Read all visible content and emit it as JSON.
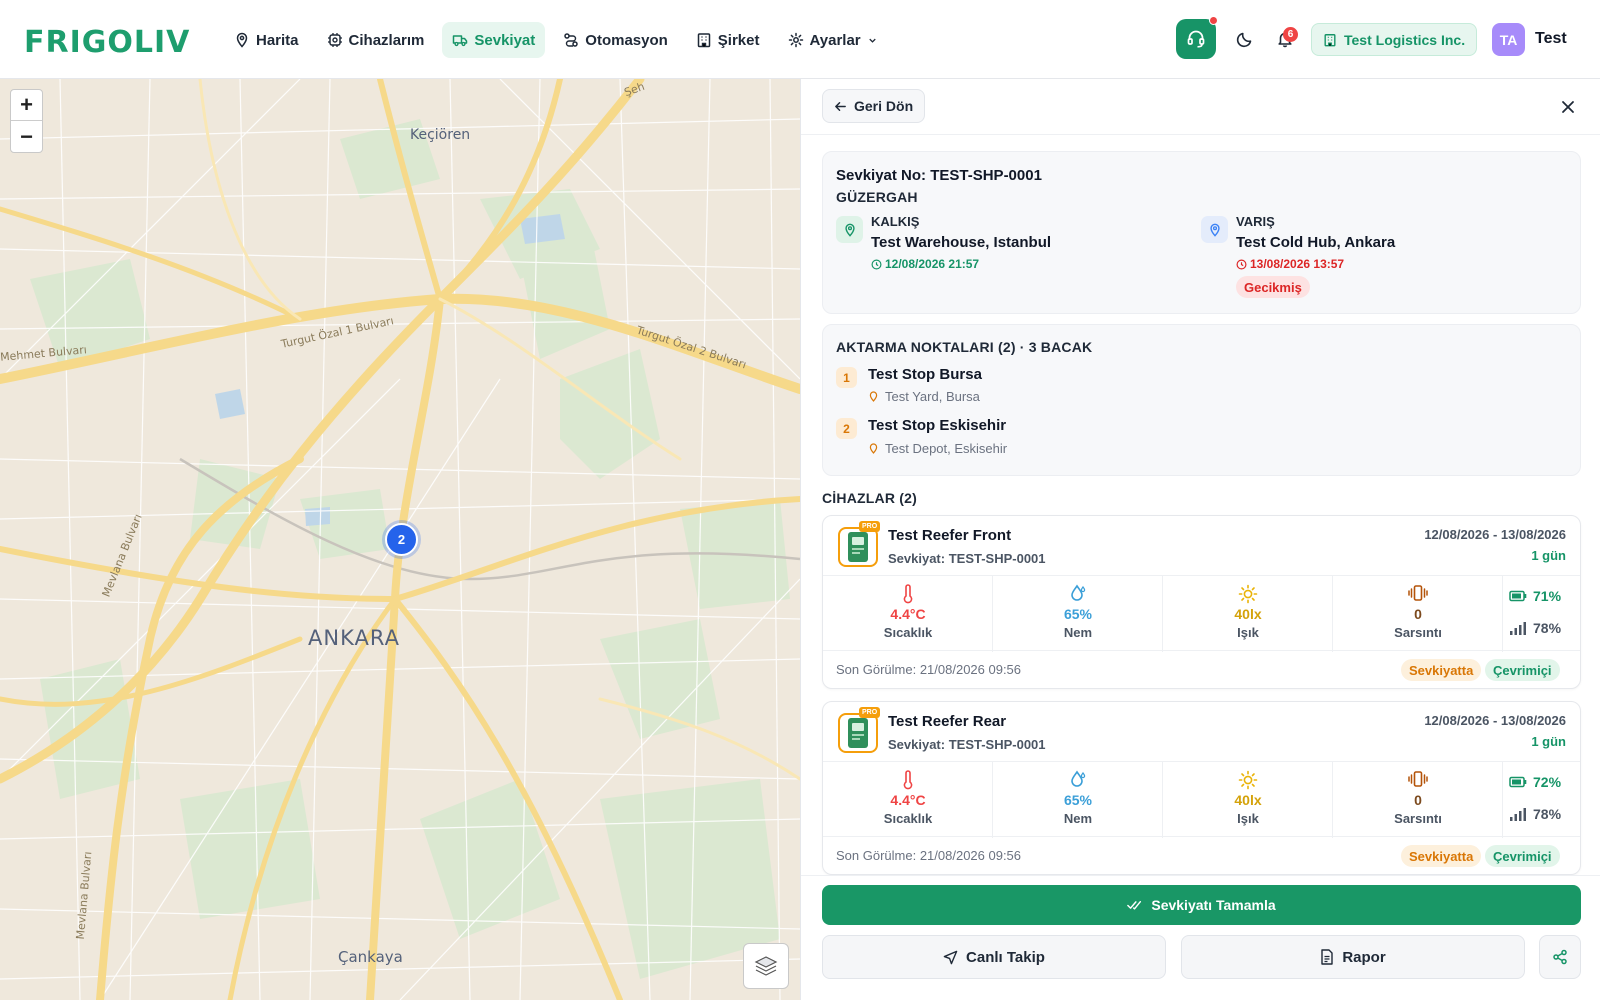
{
  "header": {
    "logo_text": "FRIGOLIVE",
    "nav": [
      {
        "label": "Harita",
        "icon": "map-pin-icon"
      },
      {
        "label": "Cihazlarım",
        "icon": "chip-icon"
      },
      {
        "label": "Sevkiyat",
        "icon": "truck-icon",
        "active": true
      },
      {
        "label": "Otomasyon",
        "icon": "route-icon"
      },
      {
        "label": "Şirket",
        "icon": "building-icon"
      },
      {
        "label": "Ayarlar",
        "icon": "gear-icon"
      }
    ],
    "notification_count": "6",
    "company": "Test Logistics Inc.",
    "avatar_initials": "TA",
    "user_name": "Test",
    "accent_color": "#179467"
  },
  "map": {
    "zoom_in": "+",
    "zoom_out": "−",
    "cluster_count": "2",
    "labels": {
      "kecioren": "Keçiören",
      "ankara": "ANKARA",
      "cankaya": "Çankaya",
      "turgut1": "Turgut Özal 1 Bulvarı",
      "turgut2": "Turgut Özal 2 Bulvarı",
      "mehmet": "Mehmet Bulvarı",
      "mevlana1": "Mevlana Bulvarı",
      "mevlana2": "Mevlana Bulvarı",
      "sehit": "Şeh"
    }
  },
  "panel": {
    "back_label": "Geri Dön",
    "shipment_no_label": "Sevkiyat No:",
    "shipment_no": "TEST-SHP-0001",
    "route_caption": "GÜZERGAH",
    "origin": {
      "head": "KALKIŞ",
      "place": "Test Warehouse, Istanbul",
      "time": "12/08/2026 21:57"
    },
    "destination": {
      "head": "VARIŞ",
      "place": "Test Cold Hub, Ankara",
      "time": "13/08/2026 13:57",
      "status": "Gecikmiş"
    },
    "stops_caption": "AKTARMA NOKTALARI (2) · 3 BACAK",
    "stops": [
      {
        "num": "1",
        "name": "Test Stop Bursa",
        "address": "Test Yard, Bursa"
      },
      {
        "num": "2",
        "name": "Test Stop Eskisehir",
        "address": "Test Depot, Eskisehir"
      }
    ],
    "devices_caption": "CİHAZLAR (2)",
    "devices": [
      {
        "name": "Test Reefer Front",
        "shipment": "Sevkiyat: TEST-SHP-0001",
        "dates": "12/08/2026 - 13/08/2026",
        "days": "1 gün",
        "pro": "PRO",
        "temp": "4.4°C",
        "temp_label": "Sıcaklık",
        "humidity": "65%",
        "humidity_label": "Nem",
        "light": "40lx",
        "light_label": "Işık",
        "shock": "0",
        "shock_label": "Sarsıntı",
        "battery": "71%",
        "signal": "78%",
        "last_seen": "Son Görülme: 21/08/2026 09:56",
        "status_ship": "Sevkiyatta",
        "status_online": "Çevrimiçi"
      },
      {
        "name": "Test Reefer Rear",
        "shipment": "Sevkiyat: TEST-SHP-0001",
        "dates": "12/08/2026 - 13/08/2026",
        "days": "1 gün",
        "pro": "PRO",
        "temp": "4.4°C",
        "temp_label": "Sıcaklık",
        "humidity": "65%",
        "humidity_label": "Nem",
        "light": "40lx",
        "light_label": "Işık",
        "shock": "0",
        "shock_label": "Sarsıntı",
        "battery": "72%",
        "signal": "78%",
        "last_seen": "Son Görülme: 21/08/2026 09:56",
        "status_ship": "Sevkiyatta",
        "status_online": "Çevrimiçi"
      }
    ],
    "complete_label": "Sevkiyatı Tamamla",
    "live_label": "Canlı Takip",
    "report_label": "Rapor"
  }
}
